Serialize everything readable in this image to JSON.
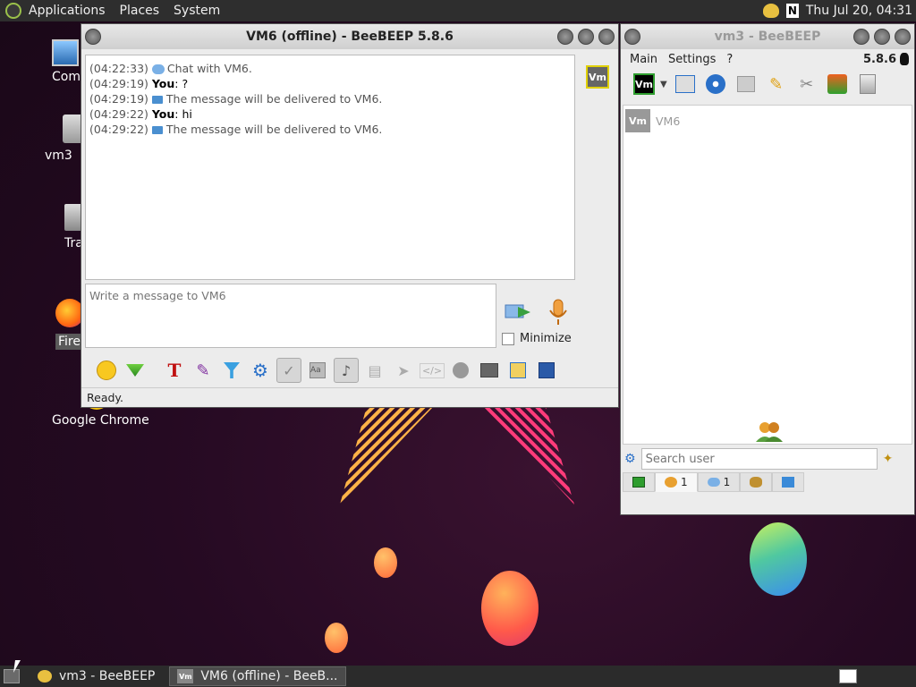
{
  "top_panel": {
    "menus": [
      "Applications",
      "Places",
      "System"
    ],
    "clock": "Thu Jul 20, 04:31"
  },
  "desktop_icons": [
    {
      "label": "Comp"
    },
    {
      "label": "vm3"
    },
    {
      "label": "Tra"
    },
    {
      "label": "Fire"
    },
    {
      "label": "Google Chrome"
    }
  ],
  "chat_window": {
    "title": "VM6 (offline) - BeeBEEP 5.8.6",
    "messages": [
      {
        "time": "(04:22:33)",
        "sender": "",
        "text": "Chat with VM6."
      },
      {
        "time": "(04:29:19)",
        "sender": "You",
        "text": ": ?"
      },
      {
        "time": "(04:29:19)",
        "sender": "",
        "text": "The message will be delivered to VM6."
      },
      {
        "time": "(04:29:22)",
        "sender": "You",
        "text": ": hi"
      },
      {
        "time": "(04:29:22)",
        "sender": "",
        "text": "The message will be delivered to VM6."
      }
    ],
    "input_placeholder": "Write a message to VM6",
    "minimize_label": "Minimize",
    "status": "Ready.",
    "avatar_label": "Vm"
  },
  "main_window": {
    "title": "vm3 - BeeBEEP",
    "menus": [
      "Main",
      "Settings",
      "?"
    ],
    "version": "5.8.6",
    "user_avatar": "Vm",
    "users": [
      {
        "avatar": "Vm",
        "name": "VM6"
      }
    ],
    "search_placeholder": "Search user",
    "tabs": [
      {
        "count": "1"
      },
      {
        "count": "1"
      }
    ]
  },
  "taskbar": {
    "tasks": [
      "vm3 - BeeBEEP",
      "VM6 (offline) - BeeB..."
    ],
    "task_icon_label": "Vm"
  },
  "colors": {
    "accent_green": "#2e7d32",
    "vm_badge": "#666666",
    "message_icon": "#4a8fd0"
  }
}
